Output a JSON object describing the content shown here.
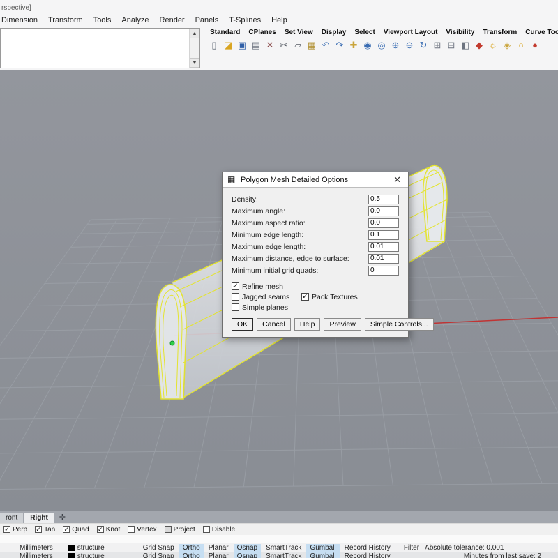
{
  "window": {
    "viewport_title_fragment": "rspective]"
  },
  "menu": {
    "items": [
      "Dimension",
      "Transform",
      "Tools",
      "Analyze",
      "Render",
      "Panels",
      "T-Splines",
      "Help"
    ]
  },
  "command_area": {
    "scroll_up_glyph": "▲",
    "scroll_down_glyph": "▼"
  },
  "toolbar": {
    "tabs": [
      "Standard",
      "CPlanes",
      "Set View",
      "Display",
      "Select",
      "Viewport Layout",
      "Visibility",
      "Transform",
      "Curve Tools"
    ],
    "icons": [
      {
        "name": "new-file-icon",
        "glyph": "▯",
        "color": "#5b6673"
      },
      {
        "name": "open-file-icon",
        "glyph": "◪",
        "color": "#d9a520"
      },
      {
        "name": "save-icon",
        "glyph": "▣",
        "color": "#2f5fa8"
      },
      {
        "name": "print-icon",
        "glyph": "▤",
        "color": "#6d7480"
      },
      {
        "name": "delete-icon",
        "glyph": "✕",
        "color": "#8a4a4a"
      },
      {
        "name": "cut-icon",
        "glyph": "✂",
        "color": "#555b63"
      },
      {
        "name": "copy-icon",
        "glyph": "▱",
        "color": "#555b63"
      },
      {
        "name": "paste-icon",
        "glyph": "▦",
        "color": "#b08f2f"
      },
      {
        "name": "undo-icon",
        "glyph": "↶",
        "color": "#3a6db3"
      },
      {
        "name": "redo-icon",
        "glyph": "↷",
        "color": "#3a6db3"
      },
      {
        "name": "pan-hand-icon",
        "glyph": "✚",
        "color": "#c9a43b"
      },
      {
        "name": "zoom-dynamic-icon",
        "glyph": "◉",
        "color": "#3a6db3"
      },
      {
        "name": "zoom-window-icon",
        "glyph": "◎",
        "color": "#3a6db3"
      },
      {
        "name": "zoom-extents-icon",
        "glyph": "⊕",
        "color": "#3a6db3"
      },
      {
        "name": "zoom-selected-icon",
        "glyph": "⊖",
        "color": "#3a6db3"
      },
      {
        "name": "rotate-view-icon",
        "glyph": "↻",
        "color": "#3a6db3"
      },
      {
        "name": "set-view-icon",
        "glyph": "⊞",
        "color": "#6d7480"
      },
      {
        "name": "viewport-layout-icon",
        "glyph": "⊟",
        "color": "#6d7480"
      },
      {
        "name": "display-mode-icon",
        "glyph": "◧",
        "color": "#6d7480"
      },
      {
        "name": "select-filter-icon",
        "glyph": "◆",
        "color": "#c23a2e"
      },
      {
        "name": "hide-object-icon",
        "glyph": "☼",
        "color": "#d9a520"
      },
      {
        "name": "lock-object-icon",
        "glyph": "◈",
        "color": "#caa53c"
      },
      {
        "name": "lightbulb-icon",
        "glyph": "○",
        "color": "#d9a520"
      },
      {
        "name": "material-icon",
        "glyph": "●",
        "color": "#c23a2e"
      }
    ]
  },
  "dialog": {
    "title": "Polygon Mesh Detailed Options",
    "icon_glyph": "▦",
    "close_glyph": "✕",
    "fields": [
      {
        "label": "Density:",
        "value": "0.5"
      },
      {
        "label": "Maximum angle:",
        "value": "0.0"
      },
      {
        "label": "Maximum aspect ratio:",
        "value": "0.0"
      },
      {
        "label": "Minimum edge length:",
        "value": "0.1"
      },
      {
        "label": "Maximum edge length:",
        "value": "0.01"
      },
      {
        "label": "Maximum distance, edge to surface:",
        "value": "0.01"
      },
      {
        "label": "Minimum initial grid quads:",
        "value": "0"
      }
    ],
    "checkboxes": [
      {
        "label": "Refine mesh",
        "checked": true,
        "mark": "✓"
      },
      {
        "label": "Jagged seams",
        "checked": false,
        "mark": ""
      },
      {
        "label": "Pack Textures",
        "checked": true,
        "mark": "✓"
      },
      {
        "label": "Simple planes",
        "checked": false,
        "mark": ""
      }
    ],
    "buttons": [
      "OK",
      "Cancel",
      "Help",
      "Preview",
      "Simple Controls..."
    ]
  },
  "viewport_tabs": {
    "tabs": [
      "ront",
      "Right"
    ],
    "pan_glyph": "✛"
  },
  "osnap": {
    "items": [
      {
        "label": "Perp",
        "checked": true,
        "mark": "✓"
      },
      {
        "label": "Tan",
        "checked": true,
        "mark": "✓"
      },
      {
        "label": "Quad",
        "checked": true,
        "mark": "✓"
      },
      {
        "label": "Knot",
        "checked": true,
        "mark": "✓"
      },
      {
        "label": "Vertex",
        "checked": false,
        "mark": ""
      },
      {
        "label": "Project",
        "checked": false,
        "mark": ""
      },
      {
        "label": "Disable",
        "checked": false,
        "mark": ""
      }
    ]
  },
  "status": {
    "units": "Millimeters",
    "layer": "structure",
    "panes": [
      {
        "label": "Grid Snap",
        "active": false
      },
      {
        "label": "Ortho",
        "active": true
      },
      {
        "label": "Planar",
        "active": false
      },
      {
        "label": "Osnap",
        "active": true
      },
      {
        "label": "SmartTrack",
        "active": false
      },
      {
        "label": "Gumball",
        "active": true
      },
      {
        "label": "Record History",
        "active": false
      }
    ],
    "filter": "Filter",
    "tolerance": "Absolute tolerance: 0.001",
    "last_save": "Minutes from last save: 2"
  }
}
